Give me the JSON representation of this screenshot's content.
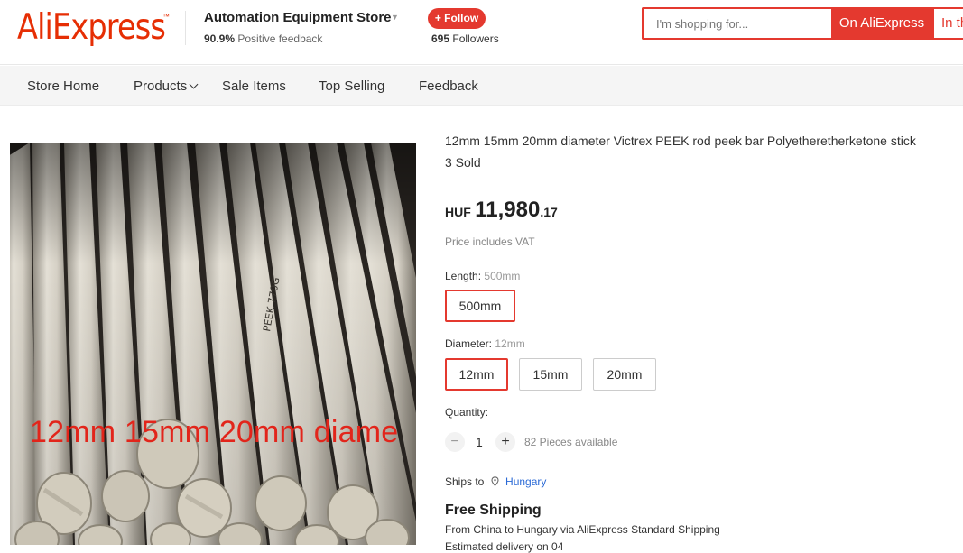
{
  "header": {
    "logo_text": "AliExpress",
    "logo_mark": "™",
    "store_name": "Automation Equipment Store",
    "feedback_percent": "90.9%",
    "feedback_label": "Positive feedback",
    "follow_label": "+ Follow",
    "followers_count": "695",
    "followers_label": "Followers",
    "search_placeholder": "I'm shopping for...",
    "search_on_ali_label": "On AliExpress",
    "search_in_store_label": "In this store"
  },
  "nav": {
    "items": [
      {
        "label": "Store Home"
      },
      {
        "label": "Products"
      },
      {
        "label": "Sale Items"
      },
      {
        "label": "Top Selling"
      },
      {
        "label": "Feedback"
      }
    ]
  },
  "gallery": {
    "overlay_text": "12mm 15mm 20mm diame"
  },
  "product": {
    "title": "12mm 15mm 20mm diameter Victrex PEEK rod peek bar Polyetheretherketone stick",
    "sold": "3 Sold",
    "price_currency": "HUF",
    "price_integer": "11,980",
    "price_decimal": ".17",
    "vat_note": "Price includes VAT",
    "length_label": "Length:",
    "length_value": "500mm",
    "length_options": [
      "500mm"
    ],
    "diameter_label": "Diameter:",
    "diameter_value": "12mm",
    "diameter_options": [
      "12mm",
      "15mm",
      "20mm"
    ],
    "quantity_label": "Quantity:",
    "quantity_minus": "−",
    "quantity_value": "1",
    "quantity_plus": "+",
    "pieces_available": "82 Pieces available",
    "ships_to_label": "Ships to",
    "ships_to_country": "Hungary",
    "shipping_title": "Free Shipping",
    "shipping_from": "From China to Hungary via AliExpress Standard Shipping",
    "estimated_delivery": "Estimated delivery on 04"
  },
  "colors": {
    "brand": "#e62e04",
    "accent": "#e4392f",
    "link": "#2b6ad6"
  },
  "icons": {
    "location": "location-pin-icon",
    "caret": "caret-down-icon"
  }
}
